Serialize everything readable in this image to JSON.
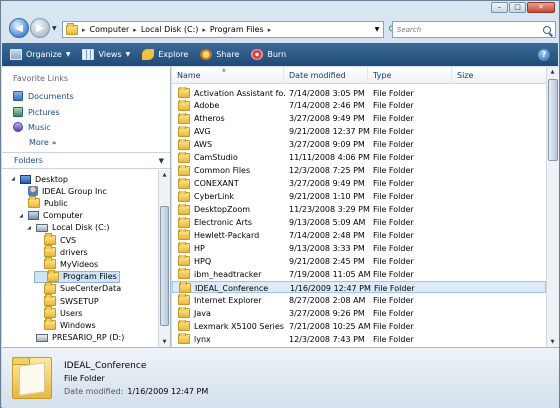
{
  "address": {
    "crumbs": [
      "Computer",
      "Local Disk (C:)",
      "Program Files"
    ],
    "search_placeholder": "Search"
  },
  "caption_buttons": {
    "minimize": "–",
    "maximize": "□",
    "close": "✕"
  },
  "toolbar": {
    "organize": "Organize",
    "views": "Views",
    "explore": "Explore",
    "share": "Share",
    "burn": "Burn"
  },
  "favorites": {
    "title": "Favorite Links",
    "items": [
      "Documents",
      "Pictures",
      "Music"
    ],
    "more": "More"
  },
  "folders": {
    "title": "Folders",
    "tree": [
      {
        "label": "Desktop",
        "icon": "desktop-icon",
        "level": 0,
        "expanded": true
      },
      {
        "label": "IDEAL Group Inc",
        "icon": "user-icon",
        "level": 1
      },
      {
        "label": "Public",
        "icon": "folder-icon",
        "level": 1
      },
      {
        "label": "Computer",
        "icon": "computer-icon",
        "level": 1,
        "expanded": true
      },
      {
        "label": "Local Disk (C:)",
        "icon": "drive-icon",
        "level": 2,
        "expanded": true
      },
      {
        "label": "CVS",
        "icon": "folder-icon",
        "level": 3
      },
      {
        "label": "drivers",
        "icon": "folder-icon",
        "level": 3
      },
      {
        "label": "MyVideos",
        "icon": "folder-icon",
        "level": 3
      },
      {
        "label": "Program Files",
        "icon": "folder-icon",
        "level": 3,
        "selected": true
      },
      {
        "label": "SueCenterData",
        "icon": "folder-icon",
        "level": 3
      },
      {
        "label": "SWSETUP",
        "icon": "folder-icon",
        "level": 3
      },
      {
        "label": "Users",
        "icon": "folder-icon",
        "level": 3
      },
      {
        "label": "Windows",
        "icon": "folder-icon",
        "level": 3
      },
      {
        "label": "PRESARIO_RP (D:)",
        "icon": "cd-drive-icon",
        "level": 2
      }
    ]
  },
  "columns": {
    "name": "Name",
    "date": "Date modified",
    "type": "Type",
    "size": "Size"
  },
  "files": [
    {
      "name": "Activation Assistant fo...",
      "date": "7/14/2008 3:05 PM",
      "type": "File Folder"
    },
    {
      "name": "Adobe",
      "date": "7/14/2008 2:46 PM",
      "type": "File Folder"
    },
    {
      "name": "Atheros",
      "date": "3/27/2008 9:49 PM",
      "type": "File Folder"
    },
    {
      "name": "AVG",
      "date": "9/21/2008 12:37 PM",
      "type": "File Folder"
    },
    {
      "name": "AWS",
      "date": "3/27/2008 9:09 PM",
      "type": "File Folder"
    },
    {
      "name": "CamStudio",
      "date": "11/11/2008 4:06 PM",
      "type": "File Folder"
    },
    {
      "name": "Common Files",
      "date": "12/3/2008 7:25 PM",
      "type": "File Folder"
    },
    {
      "name": "CONEXANT",
      "date": "3/27/2008 9:49 PM",
      "type": "File Folder"
    },
    {
      "name": "CyberLink",
      "date": "9/21/2008 1:10 PM",
      "type": "File Folder"
    },
    {
      "name": "DesktopZoom",
      "date": "11/23/2008 3:29 PM",
      "type": "File Folder"
    },
    {
      "name": "Electronic Arts",
      "date": "9/13/2008 5:09 AM",
      "type": "File Folder"
    },
    {
      "name": "Hewlett-Packard",
      "date": "7/14/2008 2:48 PM",
      "type": "File Folder"
    },
    {
      "name": "HP",
      "date": "9/13/2008 3:33 PM",
      "type": "File Folder"
    },
    {
      "name": "HPQ",
      "date": "9/21/2008 2:45 PM",
      "type": "File Folder"
    },
    {
      "name": "ibm_headtracker",
      "date": "7/19/2008 11:05 AM",
      "type": "File Folder"
    },
    {
      "name": "IDEAL_Conference",
      "date": "1/16/2009 12:47 PM",
      "type": "File Folder",
      "selected": true
    },
    {
      "name": "Internet Explorer",
      "date": "8/27/2008 2:08 AM",
      "type": "File Folder"
    },
    {
      "name": "Java",
      "date": "3/27/2008 9:26 PM",
      "type": "File Folder"
    },
    {
      "name": "Lexmark X5100 Series",
      "date": "7/21/2008 10:25 AM",
      "type": "File Folder"
    },
    {
      "name": "lynx",
      "date": "12/3/2008 7:43 PM",
      "type": "File Folder"
    }
  ],
  "details": {
    "name": "IDEAL_Conference",
    "type": "File Folder",
    "modified_label": "Date modified:",
    "modified_value": "1/16/2009 12:47 PM"
  },
  "colors": {
    "toolbar": "#2a5a88",
    "selection": "#dcebfa",
    "link": "#1a4a9a"
  }
}
